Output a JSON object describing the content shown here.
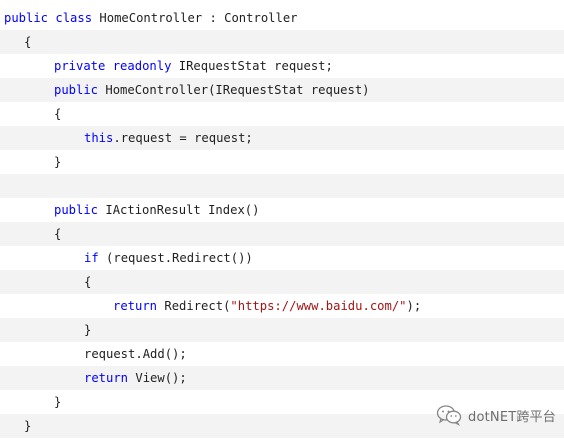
{
  "code": {
    "lines": [
      [
        {
          "t": "public",
          "c": "kw"
        },
        {
          "t": " "
        },
        {
          "t": "class",
          "c": "kw"
        },
        {
          "t": " HomeController : Controller"
        }
      ],
      [
        {
          "t": "{"
        }
      ],
      [
        {
          "t": "private",
          "c": "kw"
        },
        {
          "t": " "
        },
        {
          "t": "readonly",
          "c": "kw"
        },
        {
          "t": " IRequestStat request;"
        }
      ],
      [
        {
          "t": "public",
          "c": "kw"
        },
        {
          "t": " HomeController(IRequestStat request)"
        }
      ],
      [
        {
          "t": "{"
        }
      ],
      [
        {
          "t": "this",
          "c": "kw"
        },
        {
          "t": ".request = request;"
        }
      ],
      [
        {
          "t": "}"
        }
      ],
      [],
      [
        {
          "t": "public",
          "c": "kw"
        },
        {
          "t": " IActionResult Index()"
        }
      ],
      [
        {
          "t": "{"
        }
      ],
      [
        {
          "t": "if",
          "c": "kw"
        },
        {
          "t": " (request.Redirect())"
        }
      ],
      [
        {
          "t": "{"
        }
      ],
      [
        {
          "t": "return",
          "c": "kw"
        },
        {
          "t": " Redirect("
        },
        {
          "t": "\"https://www.baidu.com/\"",
          "c": "str"
        },
        {
          "t": ");"
        }
      ],
      [
        {
          "t": "}"
        }
      ],
      [
        {
          "t": "request.Add();"
        }
      ],
      [
        {
          "t": "return",
          "c": "kw"
        },
        {
          "t": " View();"
        }
      ],
      [
        {
          "t": "}"
        }
      ],
      [
        {
          "t": "}"
        }
      ]
    ]
  },
  "watermark": {
    "text": "dotNET跨平台",
    "icon": "wechat-icon",
    "color": "#5b5b5b"
  },
  "colors": {
    "keyword": "#0000ff",
    "string": "#a31515",
    "text": "#1f1f1f",
    "alt_row": "#f3f3f3",
    "background": "#ffffff"
  }
}
